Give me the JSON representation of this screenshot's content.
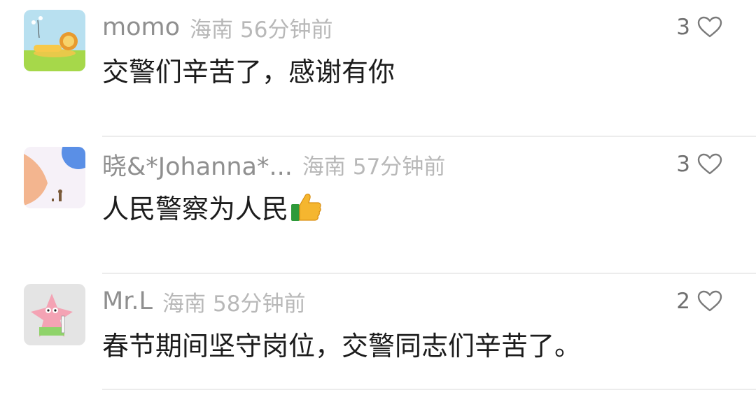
{
  "comments": [
    {
      "username": "momo",
      "location": "海南",
      "time": "56分钟前",
      "text": "交警们辛苦了，感谢有你",
      "likes": "3",
      "avatar_icon": "cartoon-lion-avatar"
    },
    {
      "username": "晓&*Johanna*...",
      "location": "海南",
      "time": "57分钟前",
      "text": "人民警察为人民",
      "emoji": "thumbs-up-icon",
      "likes": "3",
      "avatar_icon": "pastel-illustration-avatar"
    },
    {
      "username": "Mr.L",
      "location": "海南",
      "time": "58分钟前",
      "text": "春节期间坚守岗位，交警同志们辛苦了。",
      "likes": "2",
      "avatar_icon": "patrick-star-avatar"
    }
  ],
  "colors": {
    "username": "#8f8f8f",
    "meta": "#b8b8b8",
    "text": "#1c1c1c",
    "divider": "#ececec"
  }
}
